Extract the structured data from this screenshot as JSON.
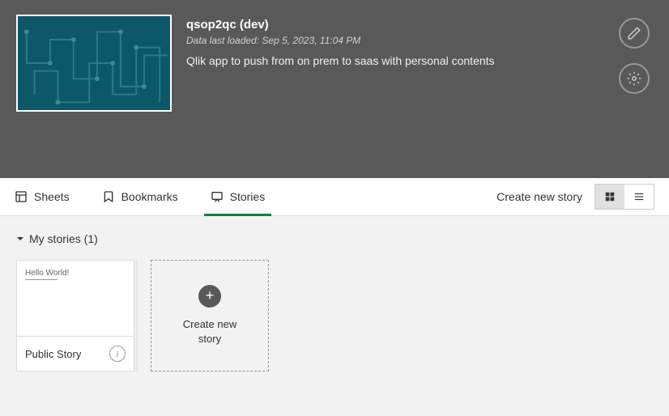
{
  "header": {
    "title": "qsop2qc (dev)",
    "meta": "Data last loaded: Sep 5, 2023, 11:04 PM",
    "description": "Qlik app to push from on prem to saas with personal contents"
  },
  "tabs": {
    "sheets": "Sheets",
    "bookmarks": "Bookmarks",
    "stories": "Stories"
  },
  "actions": {
    "createNewStory": "Create new story"
  },
  "section": {
    "title": "My stories (1)"
  },
  "story": {
    "previewText": "Hello World!",
    "title": "Public Story"
  },
  "createCard": {
    "label": "Create new story"
  }
}
